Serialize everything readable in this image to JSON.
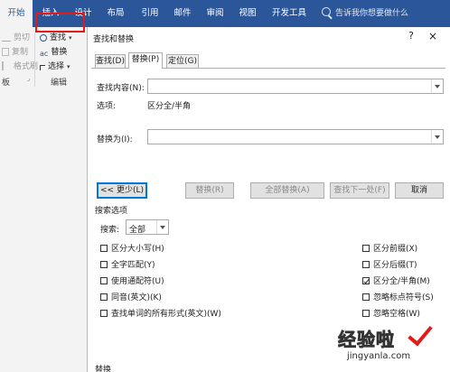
{
  "ribbon_tabs": [
    "开始",
    "插入",
    "设计",
    "布局",
    "引用",
    "邮件",
    "审阅",
    "视图",
    "开发工具"
  ],
  "active_tab": "开始",
  "tell_me_placeholder": "告诉我你想要做什么",
  "clipboard": {
    "cut": "剪切",
    "copy": "复制",
    "format_painter": "格式刷",
    "group_label": "板"
  },
  "editing": {
    "find": "查找",
    "replace": "替换",
    "select": "选择",
    "group_label": "编辑"
  },
  "dialog": {
    "title": "查找和替换",
    "help": "?",
    "close": "×",
    "tabs": [
      "查找(D)",
      "替换(P)",
      "定位(G)"
    ],
    "find_label": "查找内容(N):",
    "find_value": "",
    "options_label": "选项:",
    "options_value": "区分全/半角",
    "replace_label": "替换为(I):",
    "replace_value": "",
    "less_button": "<< 更少(L)",
    "replace_button": "替换(R)",
    "replace_all_button": "全部替换(A)",
    "find_next_button": "查找下一处(F)",
    "cancel_button": "取消",
    "search_options_heading": "搜索选项",
    "search_label": "搜索:",
    "search_value": "全部",
    "left_options": [
      {
        "label": "区分大小写(H)",
        "checked": false
      },
      {
        "label": "全字匹配(Y)",
        "checked": false
      },
      {
        "label": "使用通配符(U)",
        "checked": false
      },
      {
        "label": "同音(英文)(K)",
        "checked": false
      },
      {
        "label": "查找单词的所有形式(英文)(W)",
        "checked": false
      }
    ],
    "right_options": [
      {
        "label": "区分前缀(X)",
        "checked": false
      },
      {
        "label": "区分后缀(T)",
        "checked": false
      },
      {
        "label": "区分全/半角(M)",
        "checked": true
      },
      {
        "label": "忽略标点符号(S)",
        "checked": false
      },
      {
        "label": "忽略空格(W)",
        "checked": false
      }
    ],
    "replace_section_heading": "替换"
  },
  "watermark": {
    "text": "经验啦",
    "url": "jingyanla.com"
  },
  "colors": {
    "ribbon_blue": "#2b579a",
    "highlight_red": "#e21a1a",
    "focus_blue": "#0078d7"
  }
}
